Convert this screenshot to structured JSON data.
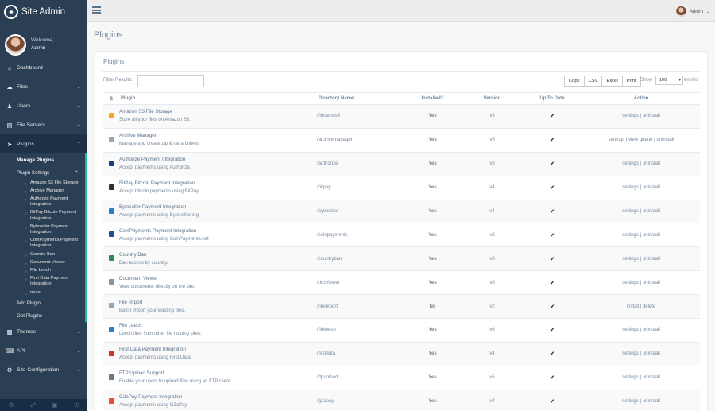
{
  "brand": {
    "title": "Site Admin"
  },
  "profile": {
    "welcome": "Welcome,",
    "name": "Admin"
  },
  "sidebar": {
    "items": [
      {
        "label": "Dashboard",
        "icon": "home-icon"
      },
      {
        "label": "Files",
        "icon": "cloud-upload-icon"
      },
      {
        "label": "Users",
        "icon": "users-icon"
      },
      {
        "label": "File Servers",
        "icon": "server-icon"
      },
      {
        "label": "Plugins",
        "icon": "rocket-icon"
      }
    ],
    "plugins_sub": {
      "manage": "Manage Plugins",
      "settings": "Plugin Settings",
      "settings_items": [
        "Amazon S3 File Storage",
        "Archive Manager",
        "Authorize Payment Integration",
        "BitPay Bitcoin Payment Integration",
        "Byteseller Payment Integration",
        "CoinPayments Payment Integration",
        "Country Ban",
        "Document Viewer",
        "File Leech",
        "First Data Payment Integration",
        "more..."
      ],
      "add": "Add Plugin",
      "get": "Get Plugins"
    },
    "bottom_items": [
      {
        "label": "Themes",
        "icon": "paint-icon"
      },
      {
        "label": "API",
        "icon": "code-icon"
      },
      {
        "label": "Site Configuration",
        "icon": "gear-icon"
      }
    ]
  },
  "topbar": {
    "user": "Admin"
  },
  "page": {
    "title": "Plugins"
  },
  "panel": {
    "title": "Plugins",
    "filter_label": "Filter Results:",
    "filter_value": "",
    "buttons": [
      "Copy",
      "CSV",
      "Excel",
      "Print"
    ],
    "show_label": "Show",
    "show_value": "100",
    "entries_label": "entries"
  },
  "table": {
    "headers": [
      "",
      "Plugin",
      "Directory Name",
      "Installed?",
      "Version",
      "Up To Date",
      "Action"
    ],
    "rows": [
      {
        "icon_color": "#f5a623",
        "name": "Amazon S3 File Storage",
        "desc": "Store all your files on Amazon S3.",
        "dir": "/filestores3",
        "installed": "Yes",
        "version": "v3",
        "action": "settings | uninstall"
      },
      {
        "icon_color": "#9aa5b1",
        "name": "Archive Manager",
        "desc": "Manage and create zip & rar archives.",
        "dir": "/archivemanager",
        "installed": "Yes",
        "version": "v5",
        "action": "settings | view queue | uninstall"
      },
      {
        "icon_color": "#1f3d7a",
        "name": "Authorize Payment Integration",
        "desc": "Accept payments using Authorize.",
        "dir": "/authorize",
        "installed": "Yes",
        "version": "v3",
        "action": "settings | uninstall"
      },
      {
        "icon_color": "#333333",
        "name": "BitPay Bitcoin Payment Integration",
        "desc": "Accept bitcoin payments using BitPay.",
        "dir": "/bitpay",
        "installed": "Yes",
        "version": "v4",
        "action": "settings | uninstall"
      },
      {
        "icon_color": "#2a7fc9",
        "name": "Byteseller Payment Integration",
        "desc": "Accept payments using Byteseller.org",
        "dir": "/byteseller",
        "installed": "Yes",
        "version": "v4",
        "action": "settings | uninstall"
      },
      {
        "icon_color": "#1c4f9c",
        "name": "CoinPayments Payment Integration",
        "desc": "Accept payments using CoinPayments.net",
        "dir": "/coinpayments",
        "installed": "Yes",
        "version": "v5",
        "action": "settings | uninstall"
      },
      {
        "icon_color": "#2e8b57",
        "name": "Country Ban",
        "desc": "Ban access by country.",
        "dir": "/countryban",
        "installed": "Yes",
        "version": "v3",
        "action": "settings | uninstall"
      },
      {
        "icon_color": "#8a94a0",
        "name": "Document Viewer",
        "desc": "View documents directly on the site.",
        "dir": "/docviewer",
        "installed": "Yes",
        "version": "v8",
        "action": "settings | uninstall"
      },
      {
        "icon_color": "#9aa5b1",
        "name": "File Import",
        "desc": "Batch import your existing files.",
        "dir": "/fileimport",
        "installed": "No",
        "version": "v2",
        "action": "install | delete"
      },
      {
        "icon_color": "#2a7fc9",
        "name": "File Leech",
        "desc": "Leech files from other file hosting sites.",
        "dir": "/fileleech",
        "installed": "Yes",
        "version": "v6",
        "action": "settings | uninstall"
      },
      {
        "icon_color": "#c0392b",
        "name": "First Data Payment Integration",
        "desc": "Accept payments using First Data.",
        "dir": "/firstdata",
        "installed": "Yes",
        "version": "v4",
        "action": "settings | uninstall"
      },
      {
        "icon_color": "#6b7785",
        "name": "FTP Upload Support",
        "desc": "Enable your users to upload files using an FTP client.",
        "dir": "/ftpupload",
        "installed": "Yes",
        "version": "v5",
        "action": "settings | uninstall"
      },
      {
        "icon_color": "#e74c3c",
        "name": "G2aPay Payment Integration",
        "desc": "Accept payments using G2aPay.",
        "dir": "/g2apay",
        "installed": "Yes",
        "version": "v4",
        "action": "settings | uninstall"
      }
    ]
  },
  "colors": {
    "sidebar": "#2a3f54",
    "accent": "#1abb9c",
    "yes": "#26b99a",
    "no": "#d9534f"
  }
}
